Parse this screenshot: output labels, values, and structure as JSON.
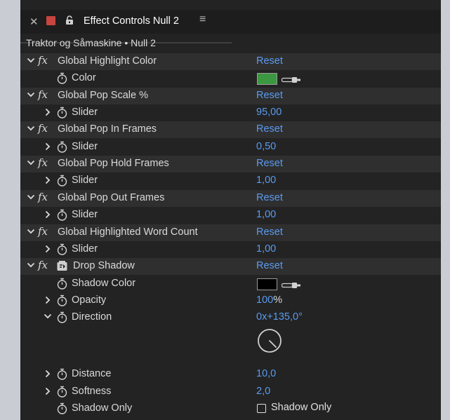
{
  "panel": {
    "tab_title": "Effect Controls Null 2",
    "breadcrumb": "Traktor og Såmaskine • Null 2"
  },
  "effects": [
    {
      "name": "Global Highlight Color",
      "reset": "Reset",
      "param_label": "Color",
      "param_color": "#3c9840"
    },
    {
      "name": "Global Pop Scale %",
      "reset": "Reset",
      "param_label": "Slider",
      "param_value": "95,00"
    },
    {
      "name": "Global Pop In Frames",
      "reset": "Reset",
      "param_label": "Slider",
      "param_value": "0,50"
    },
    {
      "name": "Global Pop Hold Frames",
      "reset": "Reset",
      "param_label": "Slider",
      "param_value": "1,00"
    },
    {
      "name": "Global Pop Out Frames",
      "reset": "Reset",
      "param_label": "Slider",
      "param_value": "1,00"
    },
    {
      "name": "Global Highlighted Word Count",
      "reset": "Reset",
      "param_label": "Slider",
      "param_value": "1,00"
    }
  ],
  "drop_shadow": {
    "name": "Drop Shadow",
    "reset": "Reset",
    "shadow_color_label": "Shadow Color",
    "shadow_color": "#000000",
    "opacity_label": "Opacity",
    "opacity_value": "100",
    "opacity_unit": "%",
    "direction_label": "Direction",
    "direction_value": "0x+135,0°",
    "distance_label": "Distance",
    "distance_value": "10,0",
    "softness_label": "Softness",
    "softness_value": "2,0",
    "shadow_only_label": "Shadow Only",
    "shadow_only_checkbox_label": "Shadow Only",
    "shadow_only_checked": false
  },
  "colors": {
    "accent_blue": "#5a9bf1",
    "panel_bg": "#232323",
    "header_row_bg": "#2f2f2f",
    "label_red": "#c7443f"
  },
  "icons": {
    "close": "close-icon",
    "lock": "lock-icon",
    "menu": "hamburger-menu-icon",
    "expand": "chevron-down-icon",
    "collapse": "chevron-right-icon",
    "fx": "fx-icon",
    "stopwatch": "stopwatch-icon",
    "eyedropper": "eyedropper-icon",
    "effect_badge": "effect-badge-icon",
    "dial": "angle-dial-icon"
  }
}
